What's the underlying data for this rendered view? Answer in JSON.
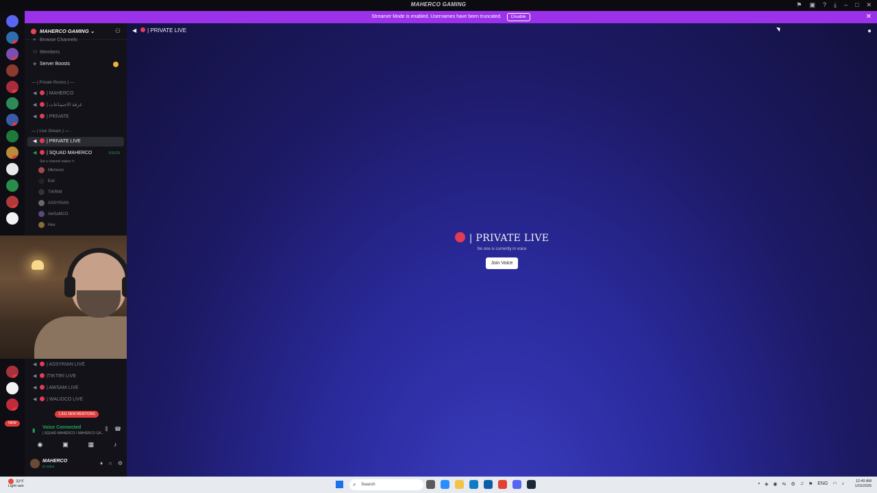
{
  "window": {
    "title": "MAHERCO GAMING",
    "controls": [
      "flag-icon",
      "screen-icon",
      "help-icon",
      "download-icon",
      "minimize-icon",
      "maximize-icon",
      "close-icon"
    ]
  },
  "banner": {
    "text": "Streamer Mode is enabled. Usernames have been truncated.",
    "button": "Disable",
    "close": "✕"
  },
  "server_list": {
    "new_pill": "NEW"
  },
  "guild": {
    "name": "MAHERCO GAMING",
    "chevron": "⌄",
    "top_items": [
      {
        "label": "Browse Channels",
        "icon": "browse-icon"
      },
      {
        "label": "Members",
        "icon": "members-icon"
      },
      {
        "label": "Server Boosts",
        "icon": "boost-icon"
      }
    ],
    "categories": [
      {
        "label": "— ( Private Rooms ) — ·"
      },
      {
        "label": "— ( Live Stream ) — ·"
      }
    ],
    "private_rooms": [
      {
        "label": "| MAHERCO"
      },
      {
        "label": "| غرفة الاجتماعات"
      },
      {
        "label": "| PRIVATE"
      }
    ],
    "live_rooms": [
      {
        "label": "| PRIVATE LIVE"
      },
      {
        "label": "| SQUAD MAHERCO",
        "timer": "3:53:25",
        "status": "Set a channel status ✎"
      }
    ],
    "voice_users": [
      "Mkmoon",
      "Evil",
      "TIKRIM",
      "ASSYRIAN",
      "AwSaMCO",
      "Hex"
    ],
    "more_rooms": [
      {
        "label": "| ASSYRIAN LIVE"
      },
      {
        "label": "|TIKTIRI LIVE"
      },
      {
        "label": "| AWSAM LIVE"
      },
      {
        "label": "| WALIDCO LIVE"
      }
    ],
    "new_mentions": "1,931 NEW MENTIONS"
  },
  "voice_panel": {
    "title": "Voice Connected",
    "subtitle": "| SQUAD MAHERCO / MAHERCO GA..."
  },
  "user_panel": {
    "name": "MAHERCO",
    "status": "In voice"
  },
  "main": {
    "channel_name": "| PRIVATE LIVE",
    "empty_title": "| PRIVATE LIVE",
    "empty_sub": "No one is currently in voice",
    "join_button": "Join Voice"
  },
  "taskbar": {
    "weather_temp": "33°F",
    "weather_desc": "Light rain",
    "search_placeholder": "Search",
    "lang": "ENG",
    "time": "12:40 AM",
    "date": "1/15/2026"
  }
}
